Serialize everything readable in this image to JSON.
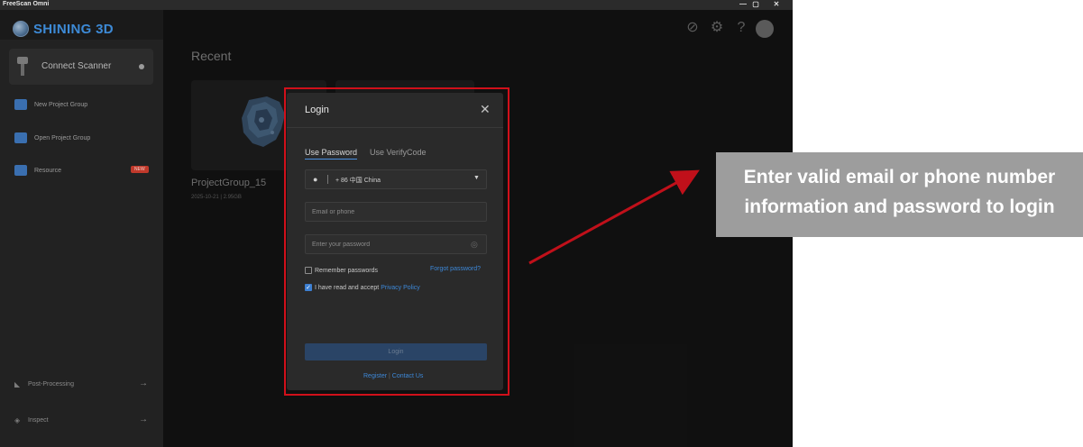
{
  "window": {
    "title": "FreeScan Omni",
    "buttons": [
      "—",
      "▢",
      "✕"
    ]
  },
  "header": {
    "brand": "SHINING 3D",
    "icons": [
      "link-icon",
      "gear-icon",
      "help-icon",
      "avatar"
    ]
  },
  "sidebar": {
    "connect_label": "Connect Scanner",
    "items": [
      {
        "label": "New Project Group",
        "icon": "new-project-icon"
      },
      {
        "label": "Open Project Group",
        "icon": "open-project-icon"
      },
      {
        "label": "Resource",
        "icon": "resource-icon",
        "badge": "NEW"
      }
    ],
    "bottom_items": [
      {
        "label": "Post-Processing",
        "icon": "post-processing-icon"
      },
      {
        "label": "Inspect",
        "icon": "inspect-icon"
      }
    ]
  },
  "main": {
    "section_title": "Recent",
    "projects": [
      {
        "name": "ProjectGroup_15",
        "meta": "2025-10-21 | 2.95GB"
      }
    ]
  },
  "login": {
    "title": "Login",
    "tabs": [
      "Use Password",
      "Use VerifyCode"
    ],
    "country_value": "+ 86 中国 China",
    "email_placeholder": "Email or phone",
    "password_placeholder": "Enter your password",
    "remember_label": "Remember passwords",
    "forgot_label": "Forgot password?",
    "accept_label": "I have read and accept",
    "privacy_label": "Privacy Policy",
    "login_button": "Login",
    "register_label": "Register",
    "contact_label": "Contact Us"
  },
  "annotation": {
    "line1": "Enter valid email or phone number",
    "line2": "information and password to login",
    "colors": {
      "frame": "#d1101a",
      "arrow": "#c0101a",
      "callout": "#9d9d9d"
    }
  }
}
